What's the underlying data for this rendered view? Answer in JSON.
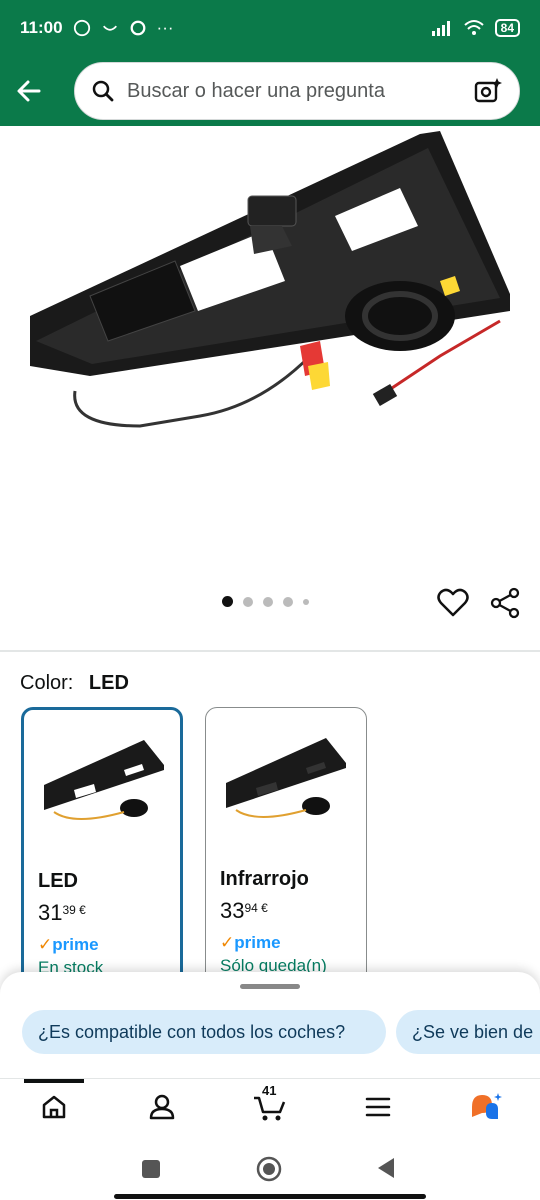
{
  "status_bar": {
    "time": "11:00",
    "battery": "84"
  },
  "search": {
    "placeholder": "Buscar o hacer una pregunta"
  },
  "carousel": {
    "total": 5,
    "active_index": 0
  },
  "color_selector": {
    "label": "Color:",
    "selected": "LED"
  },
  "variants": [
    {
      "name": "LED",
      "price_whole": "31",
      "price_fraction": "39 €",
      "prime": "prime",
      "availability": "En stock",
      "selected": true
    },
    {
      "name": "Infrarrojo",
      "price_whole": "33",
      "price_fraction": "94 €",
      "prime": "prime",
      "availability": "Sólo queda(n)",
      "selected": false
    }
  ],
  "suggestions": [
    "¿Es compatible con todos los coches?",
    "¿Se ve bien de"
  ],
  "bottom_nav": {
    "cart_count": "41"
  },
  "colors": {
    "header": "#0b7a4a",
    "prime": "#1a98ff",
    "stock": "#067d62",
    "chip_bg": "#d8ecfa",
    "selected_border": "#1a6a9a"
  }
}
